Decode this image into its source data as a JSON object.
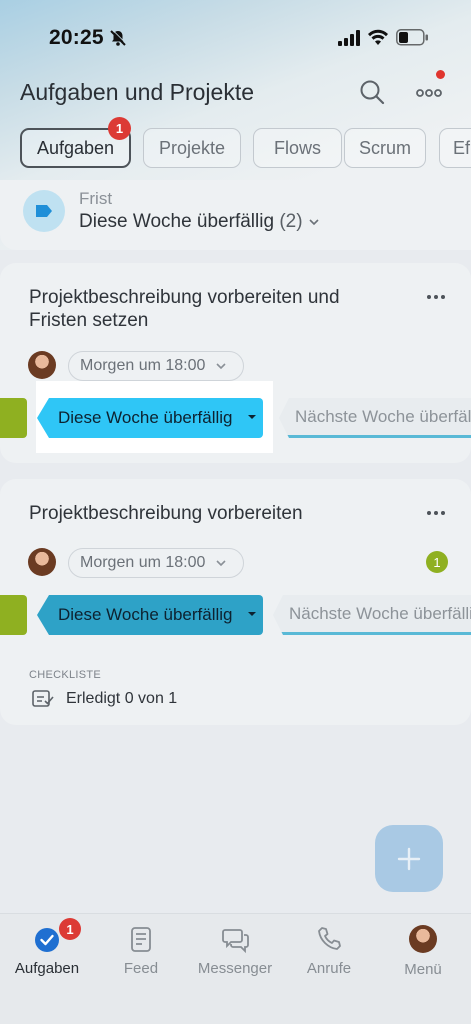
{
  "status_bar": {
    "time": "20:25"
  },
  "header": {
    "title": "Aufgaben und Projekte"
  },
  "chips": [
    {
      "label": "Aufgaben",
      "active": true,
      "badge": "1"
    },
    {
      "label": "Projekte"
    },
    {
      "label": "Flows"
    },
    {
      "label": "Scrum"
    },
    {
      "label": "Ef"
    }
  ],
  "filter": {
    "label": "Frist",
    "value": "Diese Woche überfällig",
    "count": "(2)"
  },
  "tasks": [
    {
      "title": "Projektbeschreibung vorbereiten und Fristen setzen",
      "deadline": "Morgen um 18:00",
      "stage": "Diese Woche überfällig",
      "next_stage": "Nächste Woche überfällig"
    },
    {
      "title": "Projektbeschreibung vorbereiten",
      "deadline": "Morgen um 18:00",
      "stage": "Diese Woche überfällig",
      "next_stage": "Nächste Woche überfällig",
      "comment_count": "1",
      "checklist_header": "CHECKLISTE",
      "checklist_text": "Erledigt 0 von 1"
    }
  ],
  "fab": {
    "icon": "plus-icon"
  },
  "tabbar": {
    "badge": "1",
    "items": [
      {
        "label": "Aufgaben",
        "icon": "checkmark-circle-icon",
        "active": true
      },
      {
        "label": "Feed",
        "icon": "feed-icon"
      },
      {
        "label": "Messenger",
        "icon": "chat-icon"
      },
      {
        "label": "Anrufe",
        "icon": "phone-icon"
      },
      {
        "label": "Menü",
        "icon": "avatar-icon"
      }
    ]
  },
  "colors": {
    "stage": "#2fc6f6",
    "done_green": "#8fb021",
    "badge_red": "#dc3a35",
    "tab_active_blue": "#1f6fd1"
  }
}
